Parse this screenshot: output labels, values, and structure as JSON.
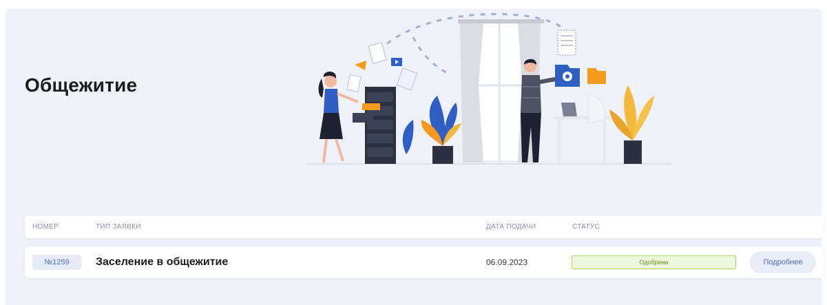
{
  "page": {
    "title": "Общежитие"
  },
  "table": {
    "headers": {
      "number": "НОМЕР",
      "type": "ТИП ЗАЯВКИ",
      "date": "ДАТА ПОДАЧИ",
      "status": "СТАТУС"
    },
    "rows": [
      {
        "number": "№1259",
        "type": "Заселение в общежитие",
        "date": "06.09.2023",
        "status": "Одобрена",
        "action": "Подробнее"
      }
    ]
  },
  "colors": {
    "background": "#eef1f7",
    "accent": "#4b72c4",
    "status_approved_bg": "#eef8dc",
    "status_approved_border": "#a9d46a",
    "status_approved_text": "#5f9a1f",
    "illustration_orange": "#f39a1e",
    "illustration_blue": "#2f5fc4"
  },
  "illustration": {
    "name": "office-illustration"
  }
}
